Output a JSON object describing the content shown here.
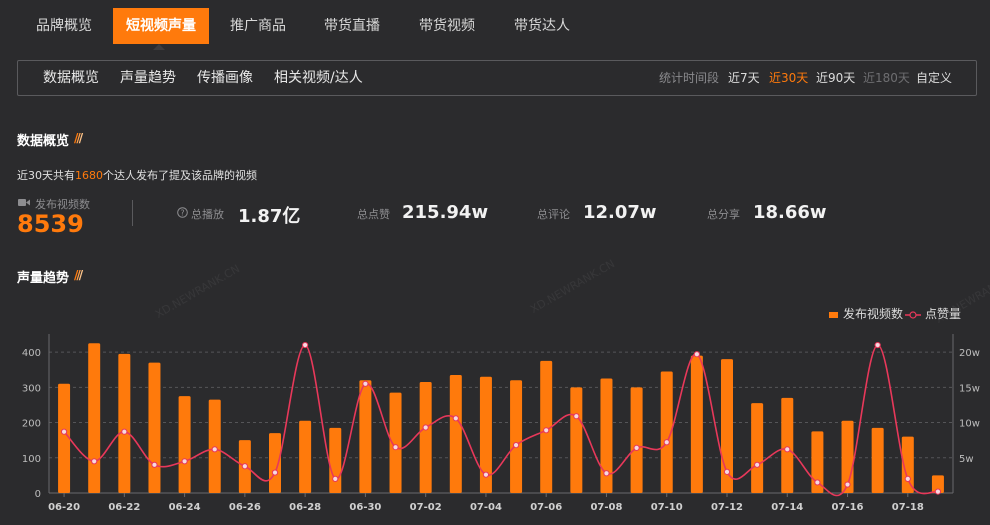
{
  "top_tabs": [
    {
      "label": "品牌概览"
    },
    {
      "label": "短视频声量"
    },
    {
      "label": "推广商品"
    },
    {
      "label": "带货直播"
    },
    {
      "label": "带货视频"
    },
    {
      "label": "带货达人"
    }
  ],
  "sub_tabs": [
    {
      "label": "数据概览"
    },
    {
      "label": "声量趋势"
    },
    {
      "label": "传播画像"
    },
    {
      "label": "相关视频/达人"
    }
  ],
  "period": {
    "label": "统计时间段",
    "options": [
      "近7天",
      "近30天",
      "近90天",
      "近180天",
      "自定义"
    ],
    "selected": "近30天"
  },
  "overview": {
    "title": "数据概览",
    "summary_prefix": "近30天共有",
    "summary_count": "1680",
    "summary_suffix": "个达人发布了提及该品牌的视频",
    "video_count_label": "发布视频数",
    "video_count": "8539",
    "plays_label": "总播放",
    "plays": "1.87亿",
    "likes_label": "总点赞",
    "likes": "215.94w",
    "comments_label": "总评论",
    "comments": "12.07w",
    "shares_label": "总分享",
    "shares": "18.66w"
  },
  "trend": {
    "title": "声量趋势",
    "legend_bar": "发布视频数",
    "legend_line": "点赞量"
  },
  "watermark": "XD.NEWRANK.CN",
  "colors": {
    "accent": "#ff7a0c",
    "line": "#e8385a",
    "background": "#2b2b2d"
  },
  "chart_data": {
    "type": "bar",
    "categories": [
      "06-20",
      "06-21",
      "06-22",
      "06-23",
      "06-24",
      "06-25",
      "06-26",
      "06-27",
      "06-28",
      "06-29",
      "06-30",
      "07-01",
      "07-02",
      "07-03",
      "07-04",
      "07-05",
      "07-06",
      "07-07",
      "07-08",
      "07-09",
      "07-10",
      "07-11",
      "07-12",
      "07-13",
      "07-14",
      "07-15",
      "07-16",
      "07-17",
      "07-18",
      "07-19"
    ],
    "x_tick_labels": [
      "06-20",
      "06-22",
      "06-24",
      "06-26",
      "06-28",
      "06-30",
      "07-02",
      "07-04",
      "07-06",
      "07-08",
      "07-10",
      "07-12",
      "07-14",
      "07-16",
      "07-18"
    ],
    "series": [
      {
        "name": "发布视频数",
        "type": "bar",
        "axis": "left",
        "values": [
          310,
          425,
          395,
          370,
          275,
          265,
          150,
          170,
          205,
          185,
          320,
          285,
          315,
          335,
          330,
          320,
          375,
          300,
          325,
          300,
          345,
          390,
          380,
          255,
          270,
          175,
          205,
          185,
          160,
          50
        ]
      },
      {
        "name": "点赞量",
        "type": "line",
        "axis": "right",
        "values": [
          8.7,
          4.5,
          8.7,
          4.0,
          4.5,
          6.2,
          3.8,
          2.9,
          21.0,
          2.0,
          15.5,
          6.5,
          9.3,
          10.6,
          2.6,
          6.8,
          8.9,
          10.9,
          2.8,
          6.4,
          7.2,
          19.7,
          3.0,
          4.0,
          6.2,
          1.5,
          1.2,
          21.0,
          2.0,
          0.2
        ]
      }
    ],
    "y_left": {
      "ticks": [
        0,
        100,
        200,
        300,
        400
      ],
      "ylim": [
        0,
        440
      ]
    },
    "y_right": {
      "tick_labels": [
        "",
        "5w",
        "10w",
        "15w",
        "20w"
      ],
      "tick_values": [
        0,
        5,
        10,
        15,
        20
      ],
      "ylim": [
        0,
        22
      ]
    },
    "legend_position": "top-right"
  }
}
